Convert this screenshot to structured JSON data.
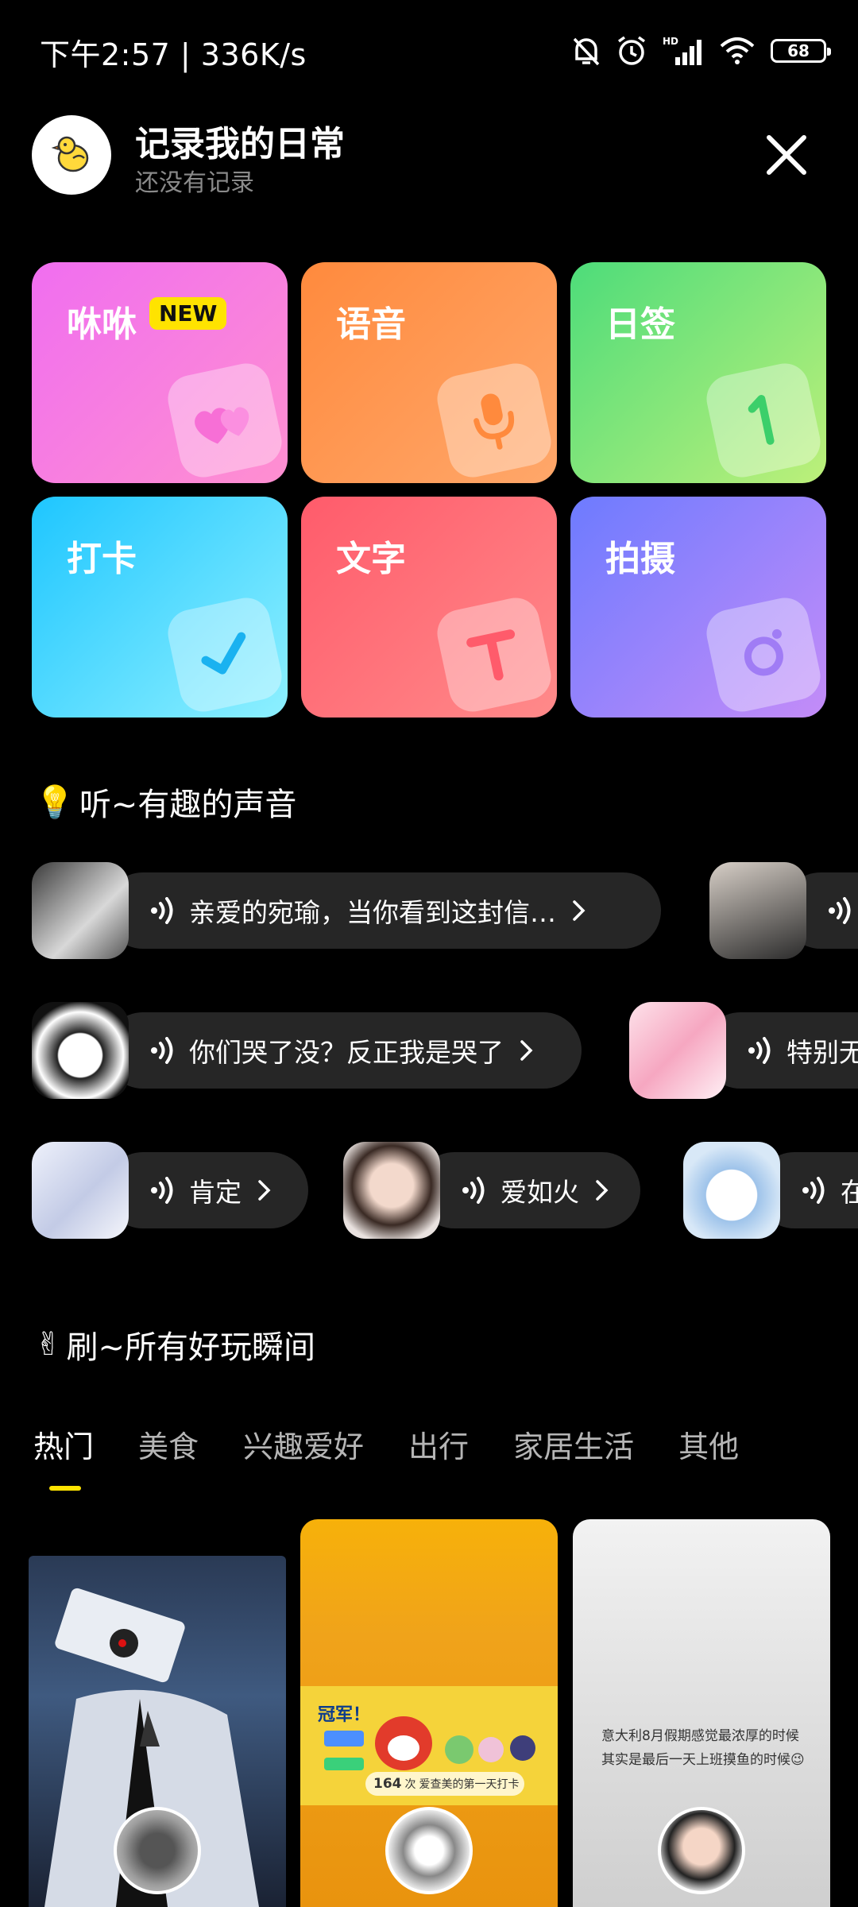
{
  "status_bar": {
    "time": "下午2:57 | 336K/s",
    "battery": "68"
  },
  "header": {
    "title": "记录我的日常",
    "subtitle": "还没有记录"
  },
  "tiles": [
    {
      "label": "咻咻",
      "badge": "NEW",
      "icon": "hearts-icon",
      "color": "#f06ef0"
    },
    {
      "label": "语音",
      "icon": "microphone-icon",
      "color": "#ff8a3d"
    },
    {
      "label": "日签",
      "icon": "number-one-icon",
      "color": "#4ddc7a"
    },
    {
      "label": "打卡",
      "icon": "check-icon",
      "color": "#1ec6ff"
    },
    {
      "label": "文字",
      "icon": "text-t-icon",
      "color": "#ff5b6b"
    },
    {
      "label": "拍摄",
      "icon": "camera-icon",
      "color": "#6d7bff"
    }
  ],
  "voice_section": {
    "emoji": "💡",
    "title": "听~有趣的声音",
    "rows": [
      [
        {
          "text": "亲爱的宛瑜，当你看到这封信…",
          "show_arrow": true
        },
        {
          "text": "",
          "show_arrow": false
        }
      ],
      [
        {
          "text": "你们哭了没？反正我是哭了",
          "show_arrow": true
        },
        {
          "text": "特别无",
          "show_arrow": false
        }
      ],
      [
        {
          "text": "肯定",
          "show_arrow": true
        },
        {
          "text": "爱如火",
          "show_arrow": true
        },
        {
          "text": "在",
          "show_arrow": false
        }
      ]
    ]
  },
  "moments_section": {
    "emoji": "✌",
    "title": "刷~所有好玩瞬间",
    "tabs": [
      "热门",
      "美食",
      "兴趣爱好",
      "出行",
      "家居生活",
      "其他"
    ],
    "active_tab": 0
  },
  "cards": [
    {
      "banner_rank": "",
      "caption": ""
    },
    {
      "banner_rank": "冠军！",
      "checkin_count": "164",
      "checkin_unit": "次",
      "checkin_text": "爱查美的第一天打卡"
    },
    {
      "caption": "意大利8月假期感觉最浓厚的时候其实是最后一天上班摸鱼的时候😉"
    }
  ]
}
